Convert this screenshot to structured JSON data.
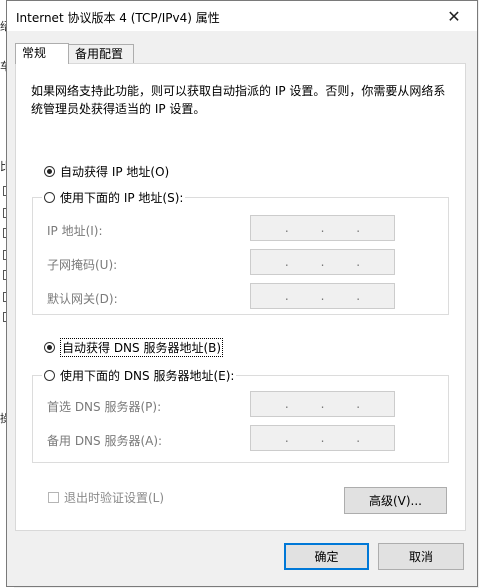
{
  "background_window": {
    "chars": [
      "绍",
      "车",
      "比",
      "操"
    ]
  },
  "dialog": {
    "title": "Internet 协议版本 4 (TCP/IPv4) 属性",
    "close_glyph": "✕"
  },
  "tabs": [
    {
      "label": "常规",
      "active": true
    },
    {
      "label": "备用配置",
      "active": false
    }
  ],
  "description": "如果网络支持此功能，则可以获取自动指派的 IP 设置。否则，你需要从网络系统管理员处获得适当的 IP 设置。",
  "ip_section": {
    "auto_label": "自动获得 IP 地址(O)",
    "manual_label": "使用下面的 IP 地址(S):",
    "selected": "auto",
    "fields": [
      {
        "label": "IP 地址(I):",
        "value": ".   .   ."
      },
      {
        "label": "子网掩码(U):",
        "value": ".   .   ."
      },
      {
        "label": "默认网关(D):",
        "value": ".   .   ."
      }
    ]
  },
  "dns_section": {
    "auto_label": "自动获得 DNS 服务器地址(B)",
    "manual_label": "使用下面的 DNS 服务器地址(E):",
    "selected": "auto",
    "fields": [
      {
        "label": "首选 DNS 服务器(P):",
        "value": ".   .   ."
      },
      {
        "label": "备用 DNS 服务器(A):",
        "value": ".   .   ."
      }
    ]
  },
  "validate_checkbox": {
    "label": "退出时验证设置(L)",
    "checked": false,
    "enabled": false
  },
  "buttons": {
    "advanced": "高级(V)...",
    "ok": "确定",
    "cancel": "取消"
  },
  "colors": {
    "default_button_border": "#0078d7",
    "disabled_text": "#7a7a7a"
  }
}
